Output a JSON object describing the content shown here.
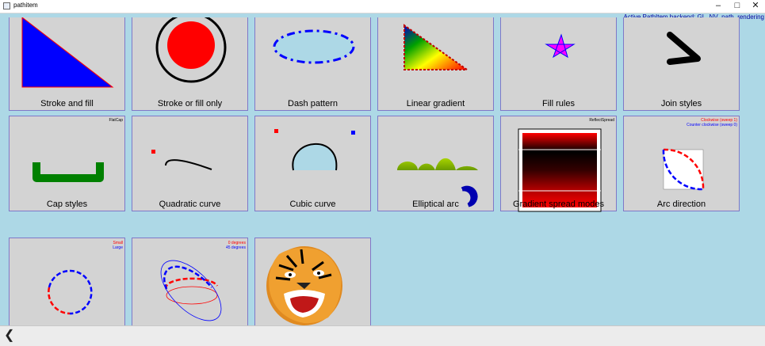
{
  "window": {
    "title": "pathitem",
    "minimize_icon": "minimize-icon",
    "maximize_icon": "maximize-icon",
    "close_icon": "close-icon"
  },
  "backend_text": "Active PathItem backend: GL_NV_path_rendering",
  "tiles": [
    {
      "label": "Stroke and fill"
    },
    {
      "label": "Stroke or fill only"
    },
    {
      "label": "Dash pattern"
    },
    {
      "label": "Linear gradient"
    },
    {
      "label": "Fill rules"
    },
    {
      "label": "Join styles"
    },
    {
      "label": "Cap styles",
      "note": "FlatCap"
    },
    {
      "label": "Quadratic curve"
    },
    {
      "label": "Cubic curve"
    },
    {
      "label": "Elliptical arc"
    },
    {
      "label": "Gradient spread modes",
      "note": "ReflectSpread"
    },
    {
      "label": "Arc direction",
      "note1": "Clockwise (sweep 1)",
      "note2": "Counter clockwise (sweep 0)"
    },
    {
      "label": "",
      "note1": "Small",
      "note2": "Large"
    },
    {
      "label": "",
      "note1": "0 degrees",
      "note2": "45 degrees"
    },
    {
      "label": "",
      "image": "tiger"
    }
  ],
  "colors": {
    "background": "#add8e6",
    "tile": "#d3d3d3",
    "tile_border": "#7f78c8",
    "backend_text": "#0000a0"
  },
  "footer": {
    "back_icon": "chevron-left-icon"
  }
}
